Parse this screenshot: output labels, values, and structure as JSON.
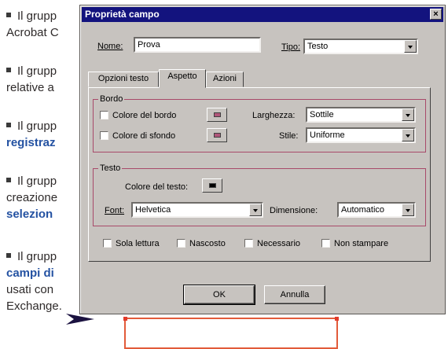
{
  "article": {
    "paragraphs": [
      {
        "line1": "Il grupp",
        "line2": "Acrobat C",
        "line2_style": "plain"
      },
      {
        "line1": "Il grupp",
        "line2": "relative a",
        "line2_style": "plain"
      },
      {
        "line1": "Il grupp",
        "line2": "registraz",
        "line2_style": "blue"
      },
      {
        "line1": "Il grupp",
        "line2": "creazione",
        "line3": "selezion",
        "line3_style": "blue"
      },
      {
        "line1": "Il grupp",
        "line2": "campi di",
        "line3": "usati con",
        "line4": "Exchange."
      }
    ]
  },
  "dialog": {
    "title": "Proprietà campo",
    "close_label": "×",
    "name_label": "Nome:",
    "name_value": "Prova",
    "type_label": "Tipo:",
    "type_value": "Testo",
    "tabs": [
      "Opzioni testo",
      "Aspetto",
      "Azioni"
    ],
    "active_tab": "Aspetto",
    "border_group": {
      "title": "Bordo",
      "border_color_label": "Colore del bordo",
      "background_color_label": "Colore di sfondo",
      "width_label": "Larghezza:",
      "width_value": "Sottile",
      "style_label": "Stile:",
      "style_value": "Uniforme",
      "border_swatch_color": "#b0567a",
      "background_swatch_color": "#b0567a"
    },
    "text_group": {
      "title": "Testo",
      "text_color_label": "Colore del testo:",
      "text_swatch_color": "#000000",
      "font_label": "Font:",
      "font_value": "Helvetica",
      "size_label": "Dimensione:",
      "size_value": "Automatico"
    },
    "checkboxes": [
      "Sola lettura",
      "Nascosto",
      "Necessario",
      "Non stampare"
    ],
    "ok_label": "OK",
    "cancel_label": "Annulla"
  },
  "colors": {
    "titlebar": "#13137e",
    "dialog_face": "#c7c3bf",
    "accent_text": "#2452a2",
    "group_border": "#a84a6a",
    "field_outline": "#e25b3a"
  }
}
